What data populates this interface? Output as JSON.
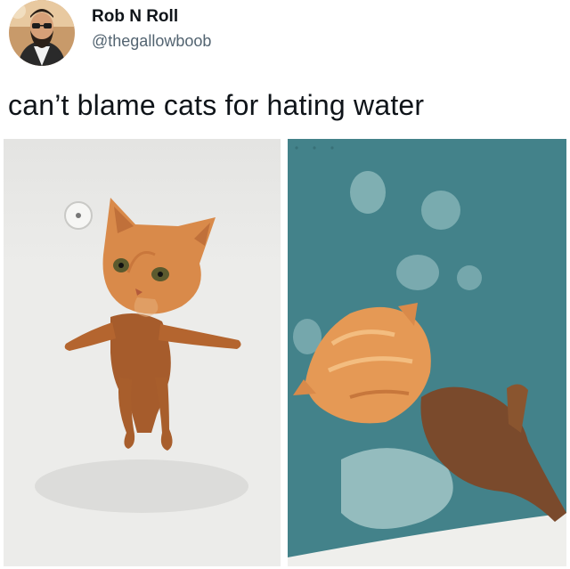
{
  "author": {
    "display_name": "Rob N Roll",
    "handle": "@thegallowboob",
    "avatar_icon": "bearded-man-with-sunglasses-avatar"
  },
  "post": {
    "text": "can’t blame cats for hating water"
  },
  "media": {
    "photos": [
      {
        "subject": "wet orange cat standing in white bathtub"
      },
      {
        "subject": "orange kitten being bathed in water over blue mat"
      }
    ]
  },
  "colors": {
    "name_text": "#0f1419",
    "handle_text": "#536471",
    "cat_orange": "#d98a4a",
    "bath_blue": "#3f7f87"
  }
}
